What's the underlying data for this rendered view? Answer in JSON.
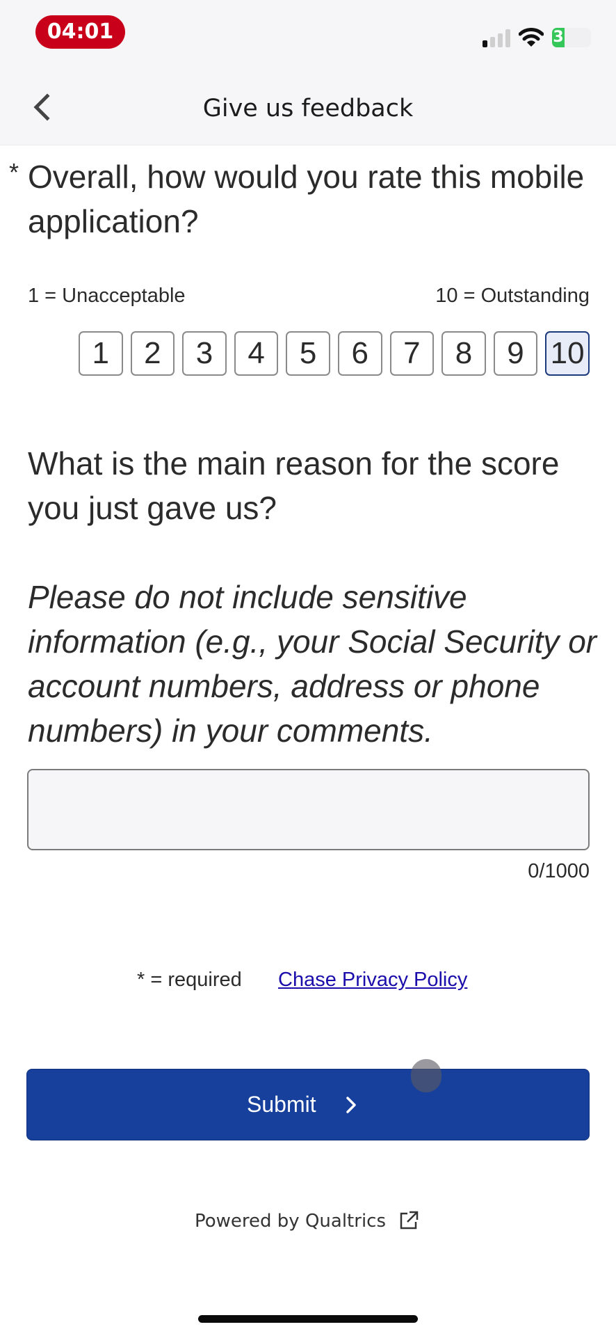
{
  "status_bar": {
    "time": "04:01",
    "battery_level": "3",
    "signal_bars_active": 1,
    "signal_bars_total": 4,
    "icons": [
      "signal-icon",
      "wifi-icon",
      "battery-icon"
    ]
  },
  "navbar": {
    "back_icon": "chevron-left-icon",
    "title": "Give us feedback"
  },
  "question1": {
    "required_marker": "*",
    "text": "Overall, how would you rate this mobile application?",
    "scale_low_label": "1 = Unacceptable",
    "scale_high_label": "10 = Outstanding",
    "options": [
      "1",
      "2",
      "3",
      "4",
      "5",
      "6",
      "7",
      "8",
      "9",
      "10"
    ],
    "selected": "10"
  },
  "question2": {
    "text": "What is the main reason for the score you just gave us?",
    "note": "Please do not include sensitive information (e.g., your Social Security or account numbers, address or phone numbers) in your comments.",
    "comment_value": "",
    "char_counter": "0/1000"
  },
  "legal": {
    "required_note": "* = required",
    "privacy_link": "Chase Privacy Policy"
  },
  "submit": {
    "label": "Submit",
    "icon": "chevron-right-icon"
  },
  "footer": {
    "powered_by": "Powered by Qualtrics",
    "icon": "external-link-icon"
  },
  "colors": {
    "primary": "#16409b",
    "link": "#1a0dab",
    "time_pill": "#c8001a",
    "selected_option_bg": "#e7ecf8",
    "battery": "#35c759"
  }
}
